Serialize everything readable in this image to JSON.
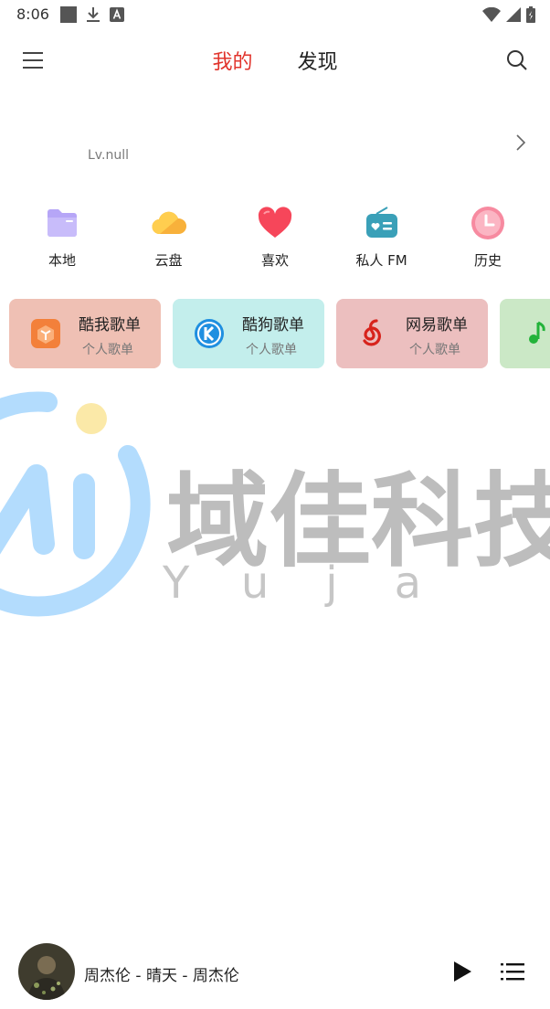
{
  "status_bar": {
    "time": "8:06"
  },
  "nav": {
    "tabs": [
      {
        "label": "我的"
      },
      {
        "label": "发现"
      }
    ]
  },
  "profile": {
    "level": "Lv.null"
  },
  "quick_actions": [
    {
      "label": "本地",
      "icon": "folder-icon",
      "color": "#b6a6f7"
    },
    {
      "label": "云盘",
      "icon": "cloud-icon",
      "color": "#f8b13b"
    },
    {
      "label": "喜欢",
      "icon": "heart-icon",
      "color": "#f6465a"
    },
    {
      "label": "私人 FM",
      "icon": "radio-icon",
      "color": "#3aa0b8"
    },
    {
      "label": "历史",
      "icon": "clock-icon",
      "color": "#f78aa0"
    }
  ],
  "playlists": [
    {
      "title": "酷我歌单",
      "subtitle": "个人歌单",
      "icon": "kuwo-icon",
      "bg": "#efc0b4"
    },
    {
      "title": "酷狗歌单",
      "subtitle": "个人歌单",
      "icon": "kugou-icon",
      "bg": "#c3eeec"
    },
    {
      "title": "网易歌单",
      "subtitle": "个人歌单",
      "icon": "netease-icon",
      "bg": "#ecbfbf"
    },
    {
      "title": "",
      "subtitle": "",
      "icon": "music-note-icon",
      "bg": "#cbe8c6"
    }
  ],
  "watermark": {
    "chars": "域佳科技",
    "letters": "Yuja"
  },
  "player": {
    "song": "周杰伦 - 晴天 - 周杰伦"
  },
  "colors": {
    "accent": "#e1332b"
  }
}
